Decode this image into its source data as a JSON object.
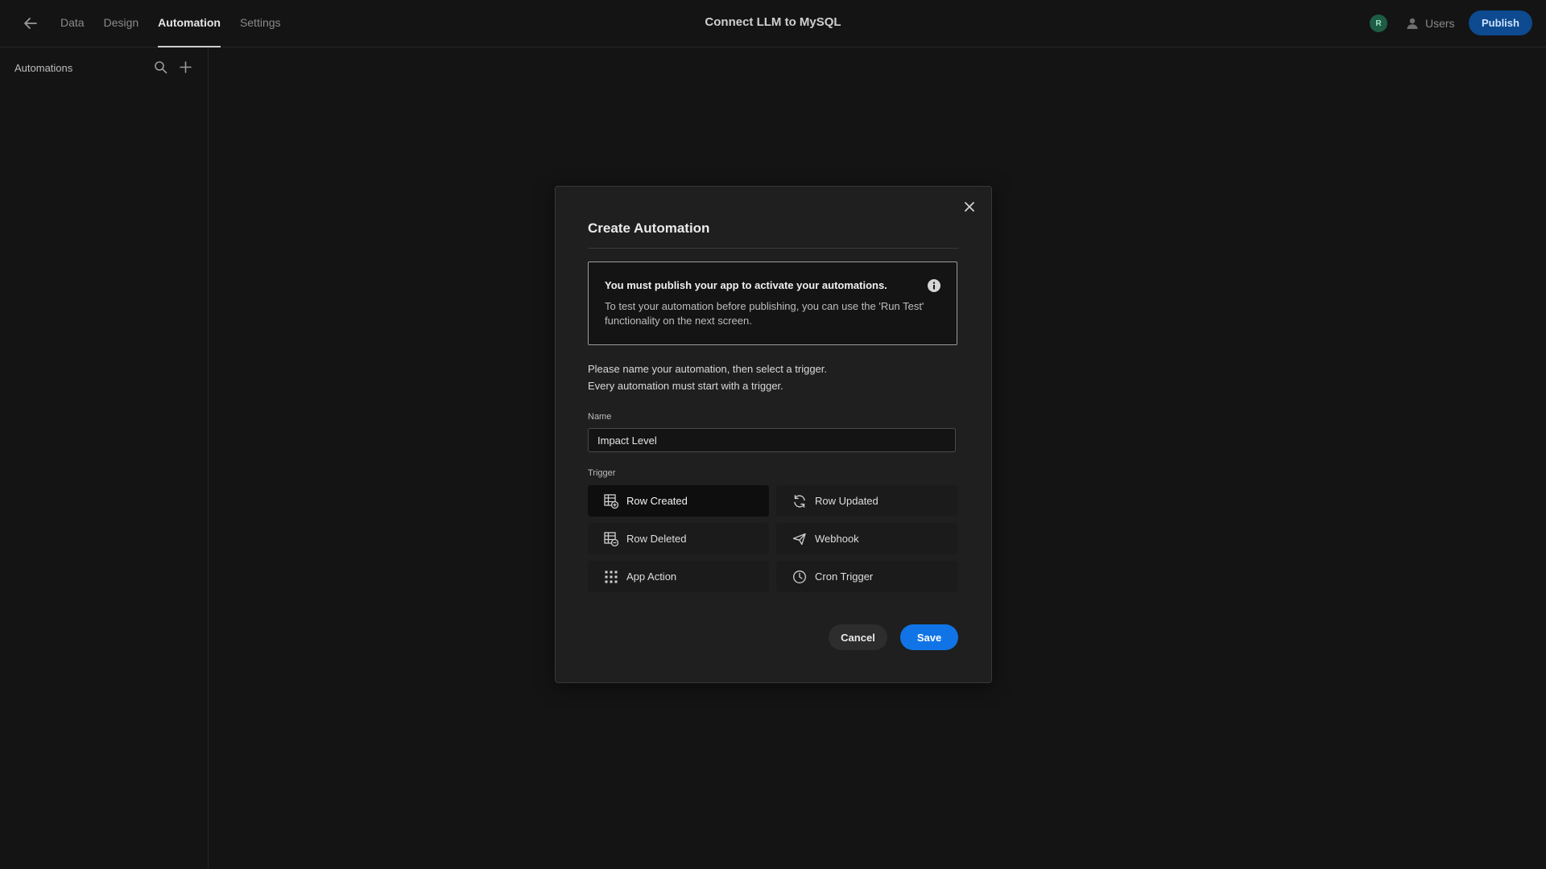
{
  "header": {
    "tabs": [
      {
        "label": "Data",
        "active": false
      },
      {
        "label": "Design",
        "active": false
      },
      {
        "label": "Automation",
        "active": true
      },
      {
        "label": "Settings",
        "active": false
      }
    ],
    "app_title": "Connect LLM to MySQL",
    "avatar_initial": "R",
    "users_label": "Users",
    "publish_label": "Publish"
  },
  "sidebar": {
    "title": "Automations"
  },
  "modal": {
    "title": "Create Automation",
    "notice": {
      "heading": "You must publish your app to activate your automations.",
      "body": "To test your automation before publishing, you can use the 'Run Test' functionality on the next screen."
    },
    "intro_line1": "Please name your automation, then select a trigger.",
    "intro_line2": "Every automation must start with a trigger.",
    "name_label": "Name",
    "name_value": "Impact Level",
    "trigger_label": "Trigger",
    "triggers": [
      {
        "label": "Row Created",
        "icon": "row-created-icon",
        "selected": true
      },
      {
        "label": "Row Updated",
        "icon": "refresh-icon",
        "selected": false
      },
      {
        "label": "Row Deleted",
        "icon": "row-deleted-icon",
        "selected": false
      },
      {
        "label": "Webhook",
        "icon": "send-icon",
        "selected": false
      },
      {
        "label": "App Action",
        "icon": "grid-dots-icon",
        "selected": false
      },
      {
        "label": "Cron Trigger",
        "icon": "clock-icon",
        "selected": false
      }
    ],
    "cancel_label": "Cancel",
    "save_label": "Save"
  },
  "colors": {
    "background": "#141414",
    "modal_bg": "#1f1f1f",
    "accent": "#1174e6",
    "publish_bg": "#0d4a8f",
    "avatar_bg": "#1e5c45"
  }
}
